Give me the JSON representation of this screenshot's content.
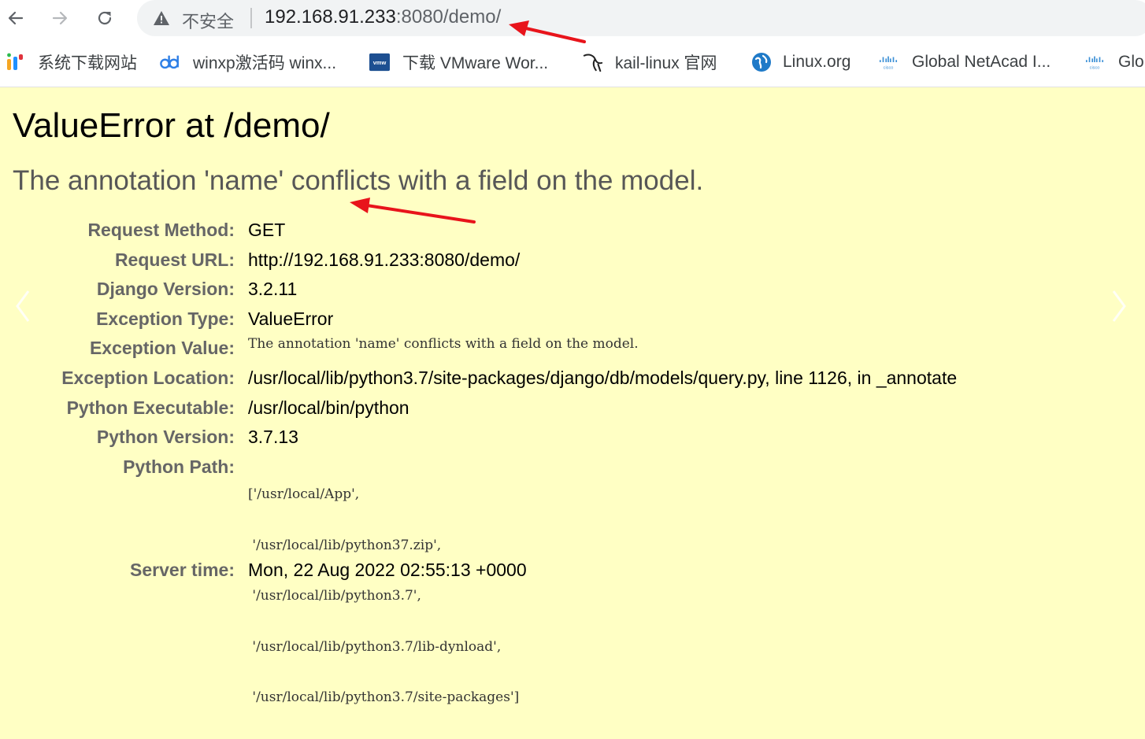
{
  "browser": {
    "insecure_label": "不安全",
    "url_host": "192.168.91.233",
    "url_rest": ":8080/demo/",
    "icons": [
      "back-icon",
      "forward-icon",
      "reload-icon",
      "warning-icon"
    ]
  },
  "bookmarks": [
    {
      "label": "系统下载网站",
      "icon": "site-logo-icon"
    },
    {
      "label": "winxp激活码 winx...",
      "icon": "dd-logo-icon"
    },
    {
      "label": "下载 VMware Wor...",
      "icon": "vmware-logo-icon"
    },
    {
      "label": "kail-linux 官网",
      "icon": "kali-dragon-icon"
    },
    {
      "label": "Linux.org",
      "icon": "globe-icon"
    },
    {
      "label": "Global NetAcad I...",
      "icon": "cisco-logo-icon"
    },
    {
      "label": "Glo",
      "icon": "cisco-logo-icon"
    }
  ],
  "page": {
    "title": "ValueError at /demo/",
    "subtitle": "The annotation 'name' conflicts with a field on the model.",
    "rows": [
      {
        "label": "Request Method:",
        "value": "GET"
      },
      {
        "label": "Request URL:",
        "value": "http://192.168.91.233:8080/demo/"
      },
      {
        "label": "Django Version:",
        "value": "3.2.11"
      },
      {
        "label": "Exception Type:",
        "value": "ValueError"
      },
      {
        "label": "Exception Value:",
        "value": "The annotation 'name' conflicts with a field on the model."
      },
      {
        "label": "Exception Location:",
        "value": "/usr/local/lib/python3.7/site-packages/django/db/models/query.py, line 1126, in _annotate"
      },
      {
        "label": "Python Executable:",
        "value": "/usr/local/bin/python"
      },
      {
        "label": "Python Version:",
        "value": "3.7.13"
      },
      {
        "label": "Python Path:",
        "lines": [
          "['/usr/local/App',",
          " '/usr/local/lib/python37.zip',",
          " '/usr/local/lib/python3.7',",
          " '/usr/local/lib/python3.7/lib-dynload',",
          " '/usr/local/lib/python3.7/site-packages']"
        ]
      },
      {
        "label": "Server time:",
        "value": "Mon, 22 Aug 2022 02:55:13 +0000"
      }
    ]
  },
  "colors": {
    "page_background": "#ffffc4",
    "label_gray": "#666666",
    "annotation_red": "#e8141b"
  }
}
